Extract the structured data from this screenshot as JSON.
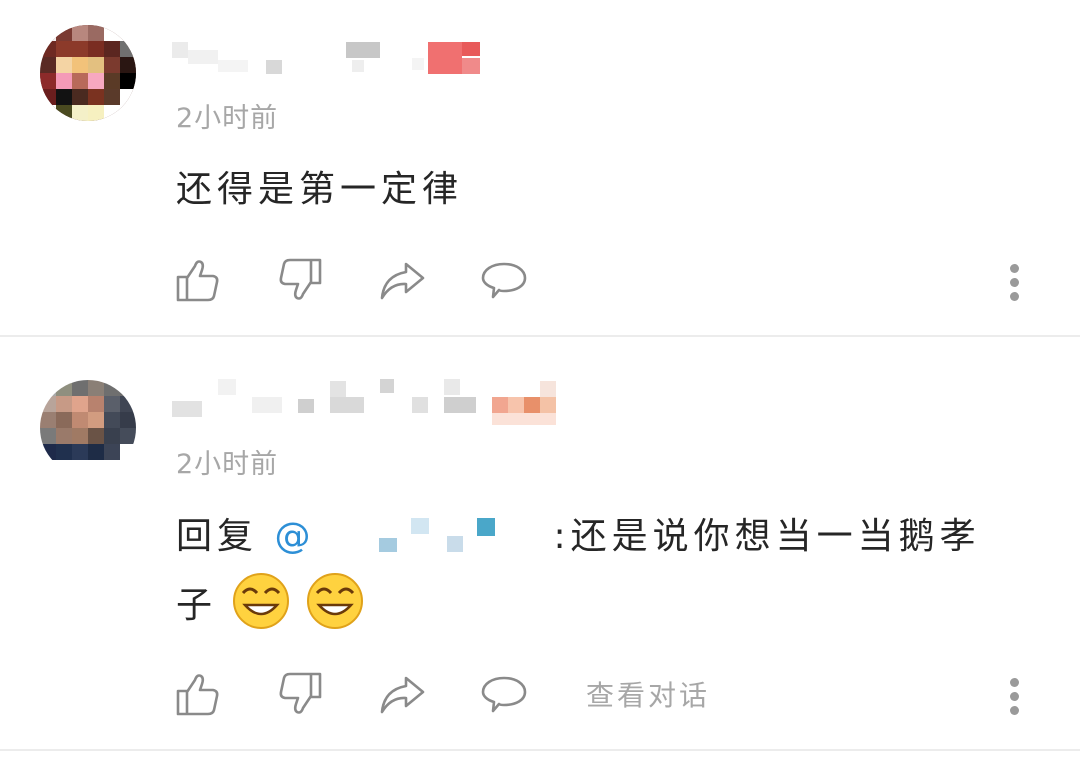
{
  "comments": [
    {
      "time": "2小时前",
      "body": "还得是第一定律"
    },
    {
      "time": "2小时前",
      "reply_prefix": "回复 ",
      "mention": "@",
      "body": ":还是说你想当一当鹅孝子",
      "view_conversation": "查看对话"
    }
  ],
  "icons": [
    "like-icon",
    "dislike-icon",
    "share-icon",
    "reply-icon",
    "more-icon",
    "grin-emoji"
  ],
  "colors": {
    "mention": "#2d8fd6",
    "secondary_text": "#a7a7a7",
    "divider": "#ececec"
  }
}
